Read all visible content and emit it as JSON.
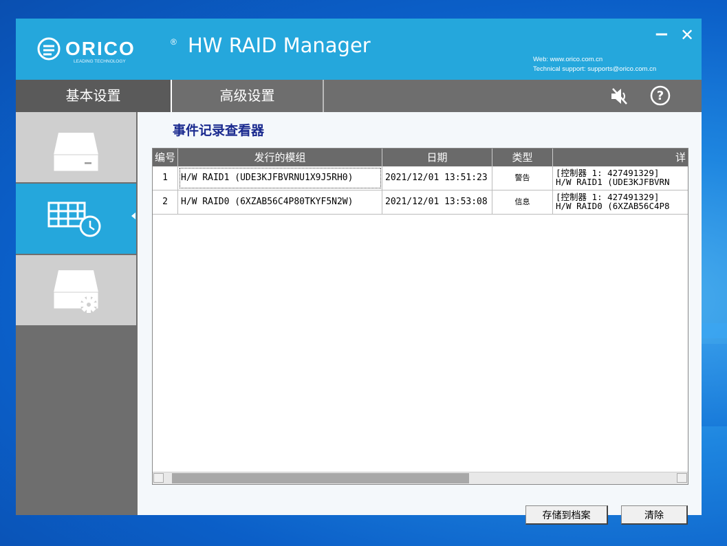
{
  "window": {
    "logo_text": "ORICO",
    "logo_tagline": "LEADING TECHNOLOGY",
    "registered_mark": "®",
    "title": "HW RAID Manager",
    "minimize_label": "−",
    "close_label": "✕",
    "web_line": "Web: www.orico.com.cn",
    "support_line": "Technical support: supports@orico.com.cn"
  },
  "tabs": [
    {
      "label": "基本设置"
    },
    {
      "label": "高级设置"
    }
  ],
  "toolbar_icons": [
    "mute-icon",
    "help-icon"
  ],
  "sidebar": {
    "items": [
      {
        "icon": "drive-icon",
        "active": false
      },
      {
        "icon": "event-log-icon",
        "active": true
      },
      {
        "icon": "drive-settings-icon",
        "active": false
      }
    ]
  },
  "content": {
    "section_title": "事件记录查看器",
    "columns": [
      "编号",
      "发行的模组",
      "日期",
      "类型",
      "详"
    ],
    "rows": [
      {
        "id": "1",
        "module": "H/W RAID1 (UDE3KJFBVRNU1X9J5RH0)",
        "date": "2021/12/01 13:51:23",
        "type": "警告",
        "desc_line1": "[控制器 1: 427491329]",
        "desc_line2": "H/W RAID1 (UDE3KJFBVRN"
      },
      {
        "id": "2",
        "module": "H/W RAID0 (6XZAB56C4P80TKYF5N2W)",
        "date": "2021/12/01 13:53:08",
        "type": "信息",
        "desc_line1": "[控制器 1: 427491329]",
        "desc_line2": "H/W RAID0 (6XZAB56C4P8"
      }
    ],
    "save_button": "存储到档案",
    "clear_button": "清除"
  },
  "colors": {
    "header": "#25a7dc",
    "tabbar": "#6e6e6e",
    "sidebar_active": "#25a7dc",
    "section_title": "#1a2a8f"
  }
}
